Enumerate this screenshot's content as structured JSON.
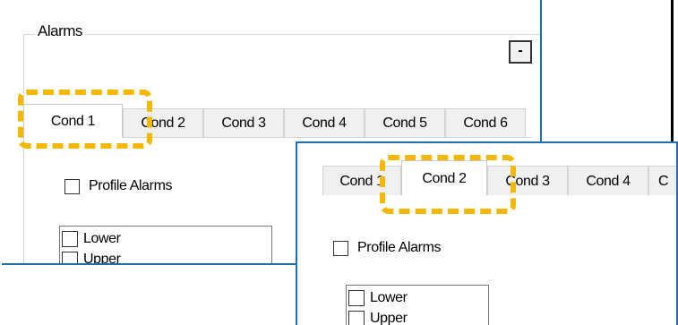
{
  "panel_a": {
    "group_title": "Alarms",
    "collapse_label": "-",
    "tabs": [
      "Cond 1",
      "Cond 2",
      "Cond 3",
      "Cond 4",
      "Cond 5",
      "Cond 6"
    ],
    "active_tab": "Cond 1",
    "profile_alarms_label": "Profile Alarms",
    "list_items": [
      "Lower",
      "Upper"
    ]
  },
  "panel_b": {
    "tabs": [
      "Cond 1",
      "Cond 2",
      "Cond 3",
      "Cond 4",
      "C"
    ],
    "active_tab": "Cond 2",
    "profile_alarms_label": "Profile Alarms",
    "list_items": [
      "Lower",
      "Upper"
    ]
  },
  "colors": {
    "highlight": "#f5b800",
    "panel_border": "#1f6fb5"
  }
}
